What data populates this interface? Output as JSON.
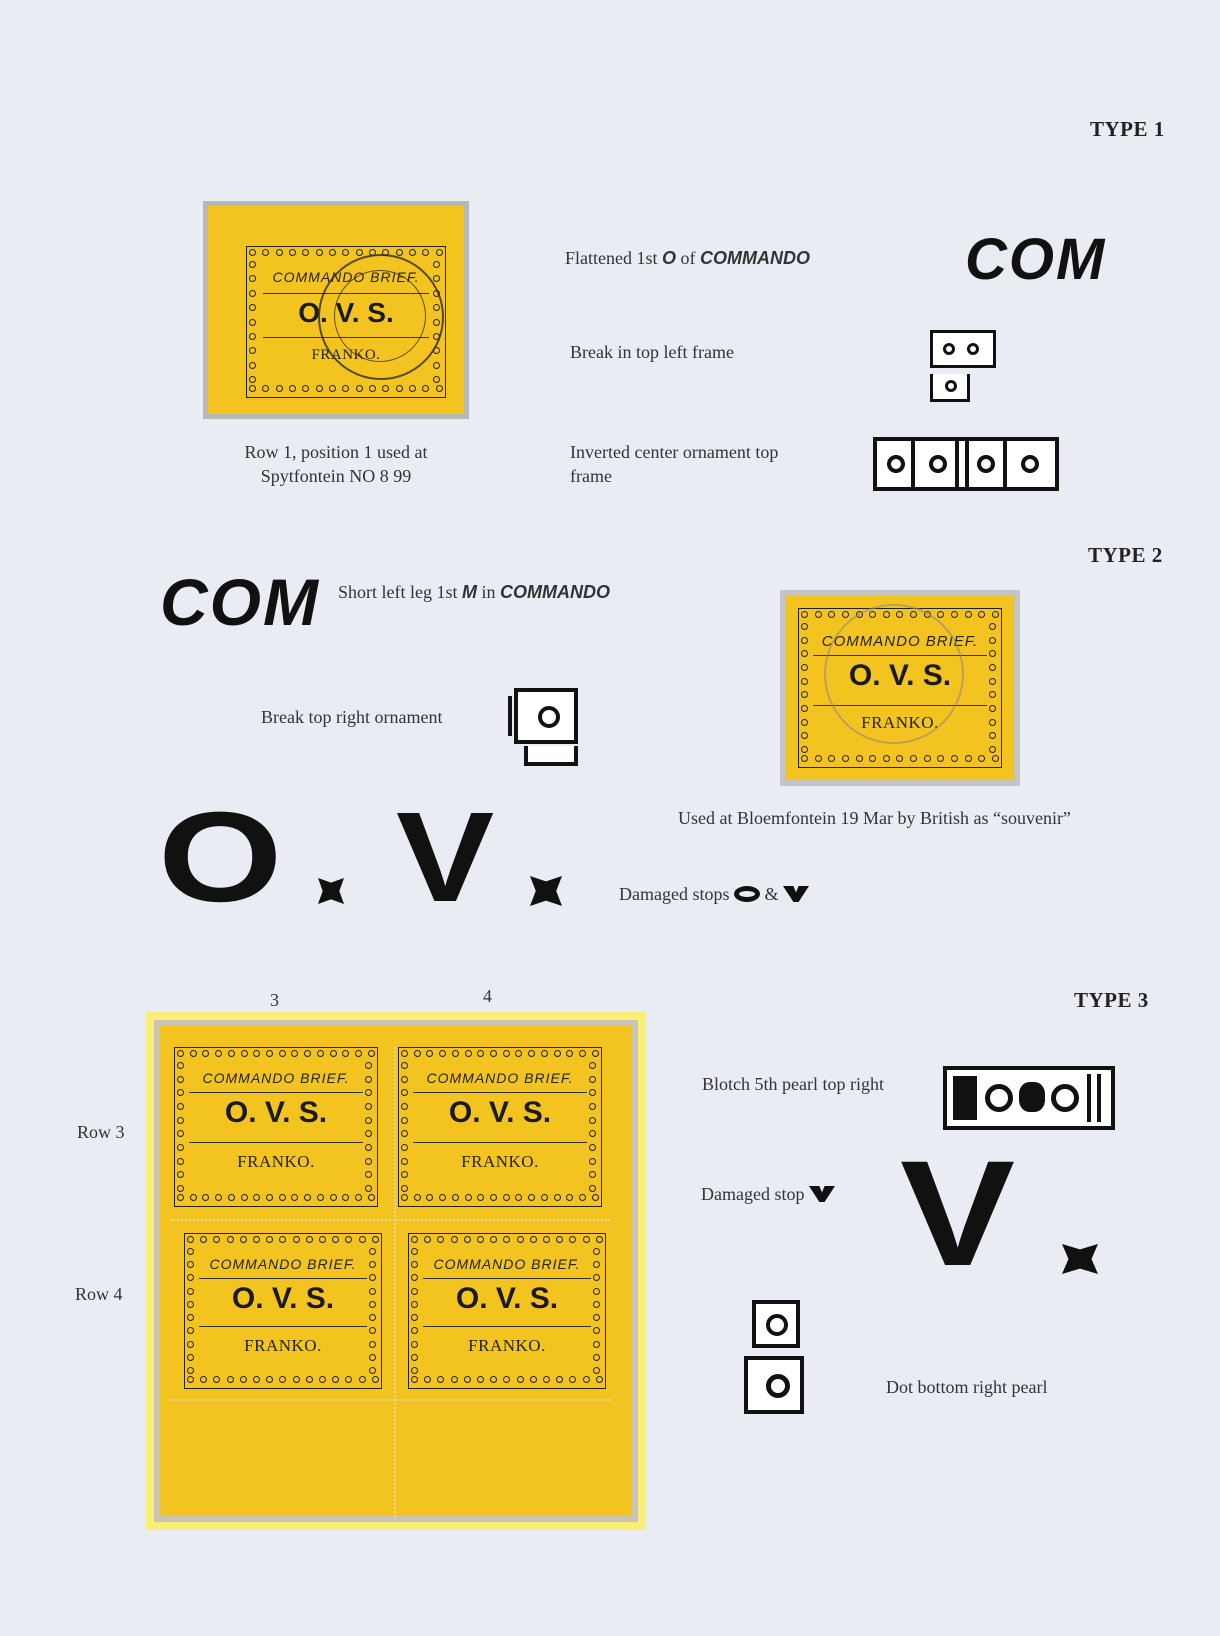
{
  "type1": {
    "heading": "TYPE 1",
    "stamp_caption_line1": "Row 1, position 1 used at",
    "stamp_caption_line2": "Spytfontein NO 8 99",
    "note1_prefix": "Flattened 1st ",
    "note1_letter": "O",
    "note1_mid": " of ",
    "note1_word": "COMMANDO",
    "note1_sample": "COM",
    "note2": "Break in top left frame",
    "note3_line1": "Inverted center ornament top",
    "note3_line2": "frame"
  },
  "type2": {
    "heading": "TYPE 2",
    "sample_com": "COM",
    "note1_prefix": "Short left leg 1st ",
    "note1_letter": "M",
    "note1_mid": " in ",
    "note1_word": "COMMANDO",
    "note2": "Break top right ornament",
    "stamp_caption": "Used at Bloemfontein 19 Mar by British as “souvenir”",
    "big_o": "O",
    "big_v": "V",
    "note3": "Damaged stops",
    "note3_amp": "&"
  },
  "type3": {
    "heading": "TYPE 3",
    "col3": "3",
    "col4": "4",
    "row3": "Row 3",
    "row4": "Row 4",
    "note1": "Blotch 5th pearl top right",
    "note2": "Damaged stop",
    "note3": "Dot bottom right pearl",
    "big_v": "V"
  },
  "stamp_text": {
    "line1": "COMMANDO BRIEF.",
    "line2": "O. V. S.",
    "line3": "FRANKO."
  },
  "colors": {
    "stamp_yellow": "#f3c41f",
    "page_bg": "#e9edf3"
  }
}
